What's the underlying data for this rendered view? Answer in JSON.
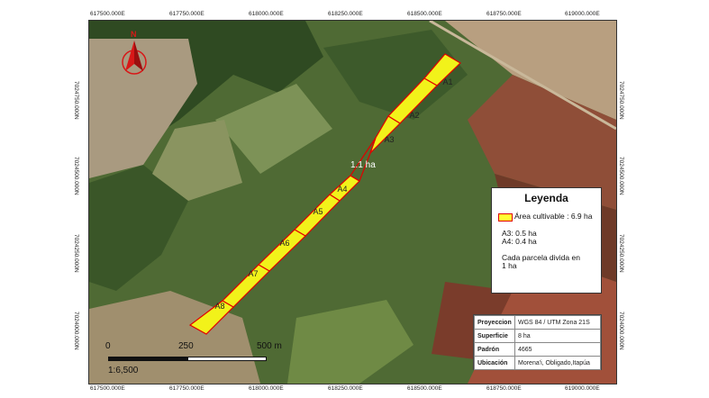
{
  "coords": {
    "top": [
      "617500.000E",
      "617750.000E",
      "618000.000E",
      "618250.000E",
      "618500.000E",
      "618750.000E",
      "619000.000E"
    ],
    "bottom": [
      "617500.000E",
      "617750.000E",
      "618000.000E",
      "618250.000E",
      "618500.000E",
      "618750.000E",
      "619000.000E"
    ],
    "left": [
      "7024750.000N",
      "7024500.000N",
      "7024250.000N",
      "7024000.000N"
    ],
    "right": [
      "7024750.000N",
      "7024500.000N",
      "7024250.000N",
      "7024000.000N"
    ]
  },
  "north_arrow": {
    "letter": "N"
  },
  "parcels": [
    "A1",
    "A2",
    "A3",
    "A4",
    "A5",
    "A6",
    "A7",
    "A8"
  ],
  "area_annotation": "1.1 ha",
  "legend": {
    "title": "Leyenda",
    "item_label": "Área cultivable : 6.9 ha",
    "line1": "A3: 0.5 ha",
    "line2": "A4: 0.4 ha",
    "line3": "Cada parcela divida en",
    "line4": "1 ha"
  },
  "info": {
    "rows": [
      {
        "key": "Proyeccion",
        "value": "WGS 84 / UTM Zona 21S"
      },
      {
        "key": "Superficie",
        "value": "8 ha"
      },
      {
        "key": "Padrón",
        "value": "4665"
      },
      {
        "key": "Ubicación",
        "value": "Morena'i, Obligado,Itapúa"
      }
    ]
  },
  "scale": {
    "t0": "0",
    "t1": "250",
    "t2": "500 m",
    "ratio": "1:6,500"
  },
  "colors": {
    "parcel_fill": "#f2f21a",
    "parcel_stroke": "#e00000",
    "north_arrow": "#d81818"
  }
}
